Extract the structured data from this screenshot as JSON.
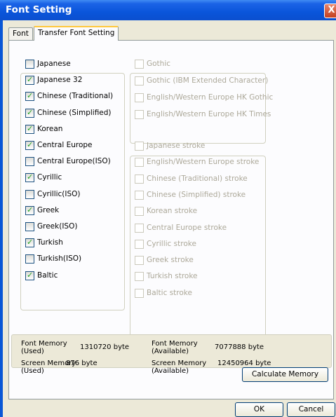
{
  "window": {
    "title": "Font Setting",
    "close_label": "X"
  },
  "tabs": [
    {
      "label": "Font",
      "active": false
    },
    {
      "label": "Transfer Font Setting",
      "active": true
    }
  ],
  "languages": [
    {
      "label": "Japanese",
      "checked": false
    },
    {
      "label": "Japanese 32",
      "checked": true
    },
    {
      "label": "Chinese (Traditional)",
      "checked": true
    },
    {
      "label": "Chinese (Simplified)",
      "checked": true
    },
    {
      "label": "Korean",
      "checked": true
    },
    {
      "label": "Central Europe",
      "checked": true
    },
    {
      "label": "Central Europe(ISO)",
      "checked": false
    },
    {
      "label": "Cyrillic",
      "checked": true
    },
    {
      "label": "Cyrillic(ISO)",
      "checked": false
    },
    {
      "label": "Greek",
      "checked": true
    },
    {
      "label": "Greek(ISO)",
      "checked": false
    },
    {
      "label": "Turkish",
      "checked": true
    },
    {
      "label": "Turkish(ISO)",
      "checked": false
    },
    {
      "label": "Baltic",
      "checked": true
    }
  ],
  "typefaces": [
    {
      "label": "Gothic"
    },
    {
      "label": "Gothic (IBM Extended Character)"
    },
    {
      "label": "English/Western Europe HK Gothic"
    },
    {
      "label": "English/Western Europe HK Times"
    }
  ],
  "strokes": [
    {
      "label": "Japanese stroke"
    },
    {
      "label": "English/Western Europe stroke"
    },
    {
      "label": "Chinese (Traditional) stroke"
    },
    {
      "label": "Chinese (Simplified) stroke"
    },
    {
      "label": "Korean stroke"
    },
    {
      "label": "Central Europe stroke"
    },
    {
      "label": "Cyrillic stroke"
    },
    {
      "label": "Greek stroke"
    },
    {
      "label": "Turkish stroke"
    },
    {
      "label": "Baltic stroke"
    }
  ],
  "memory": {
    "font_used_label_1": "Font Memory",
    "font_used_label_2": "(Used)",
    "font_used_value": "1310720 byte",
    "font_avail_label_1": "Font Memory",
    "font_avail_label_2": "(Available)",
    "font_avail_value": "7077888 byte",
    "screen_used_label_1": "Screen Memory",
    "screen_used_label_2": "(Used)",
    "screen_used_value": "876 byte",
    "screen_avail_label_1": "Screen Memory",
    "screen_avail_label_2": "(Available)",
    "screen_avail_value": "12450964 byte"
  },
  "buttons": {
    "calculate": "Calculate Memory",
    "ok": "OK",
    "cancel": "Cancel"
  }
}
